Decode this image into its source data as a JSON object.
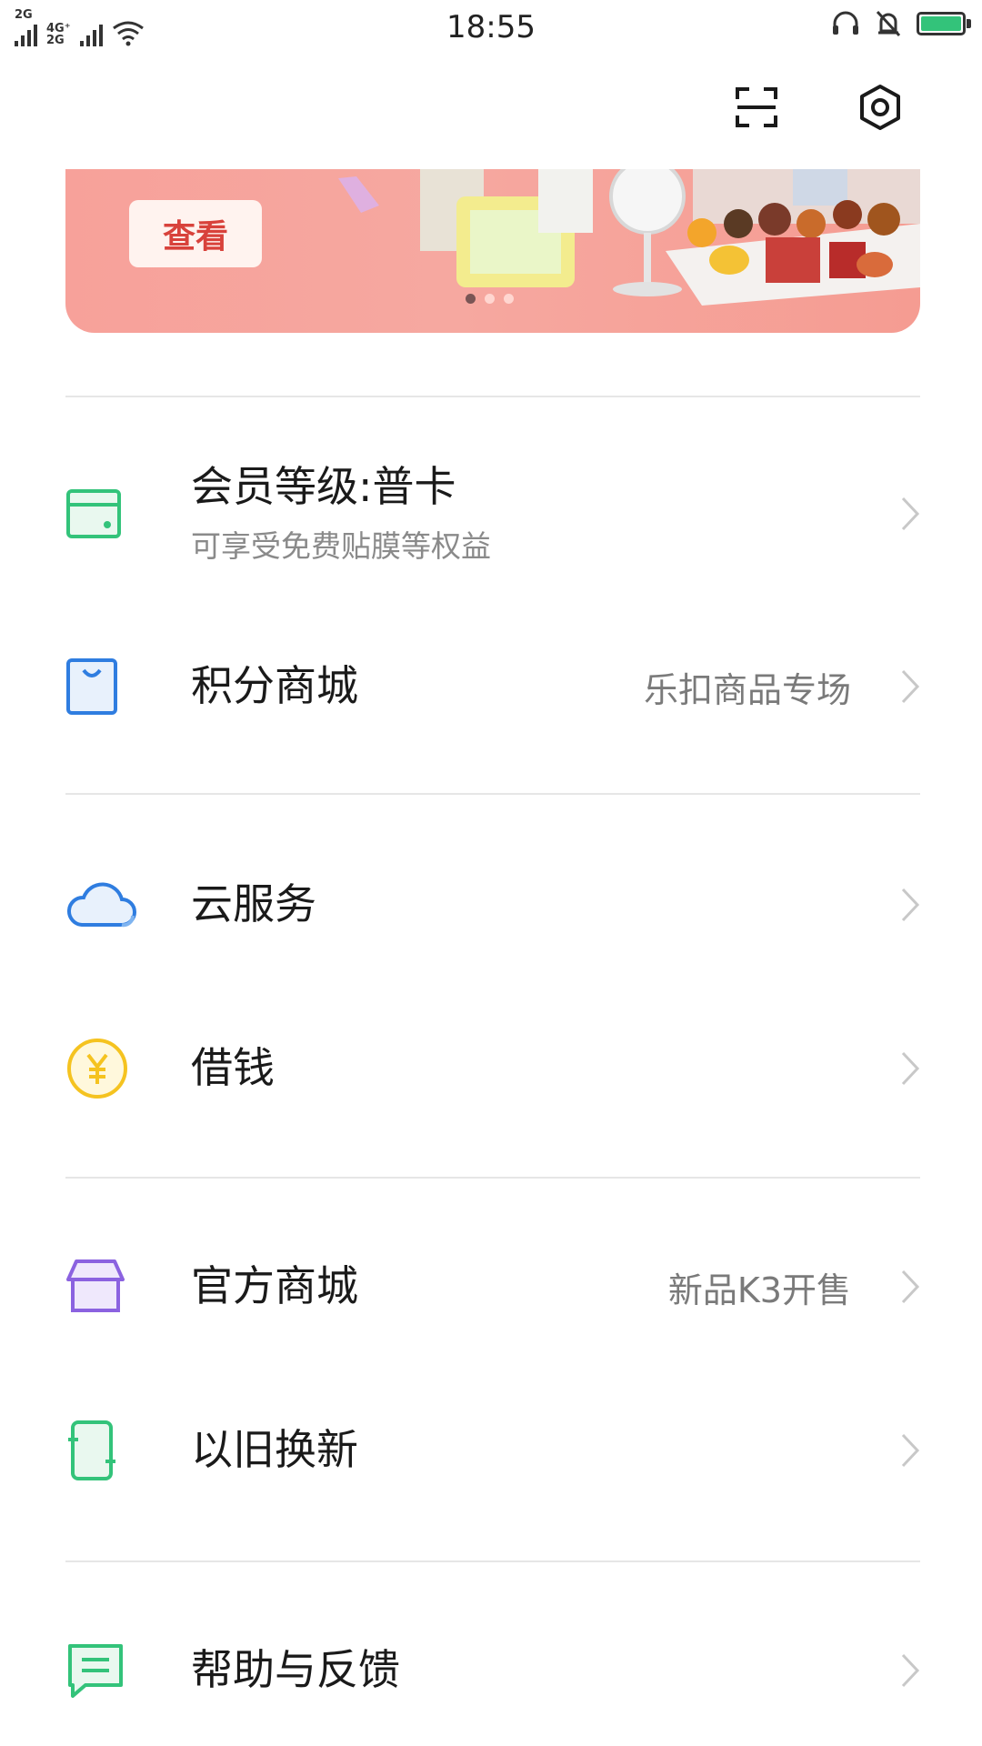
{
  "status_bar": {
    "net_top": "2G",
    "net_mid": "4G⁺",
    "net_bot": "2G",
    "time": "18:55"
  },
  "top_actions": {
    "scan_icon": "scan-icon",
    "settings_icon": "gear-icon"
  },
  "banner": {
    "button_label": "查看",
    "dots": 3,
    "active_dot": 0
  },
  "menu": {
    "membership": {
      "title": "会员等级:普卡",
      "subtitle": "可享受免费贴膜等权益",
      "icon": "card-icon",
      "color": "#33c37a"
    },
    "points_mall": {
      "title": "积分商城",
      "hint": "乐扣商品专场",
      "icon": "shopping-bag-icon",
      "color": "#2f7de0"
    },
    "cloud": {
      "title": "云服务",
      "icon": "cloud-icon",
      "color": "#2f7de0"
    },
    "borrow": {
      "title": "借钱",
      "icon": "yen-coin-icon",
      "color": "#f5c320"
    },
    "official_mall": {
      "title": "官方商城",
      "hint": "新品K3开售",
      "icon": "store-box-icon",
      "color": "#8b62e0"
    },
    "trade_in": {
      "title": "以旧换新",
      "icon": "phone-swap-icon",
      "color": "#33c37a"
    },
    "help": {
      "title": "帮助与反馈",
      "icon": "chat-bubble-icon",
      "color": "#33c37a"
    }
  }
}
